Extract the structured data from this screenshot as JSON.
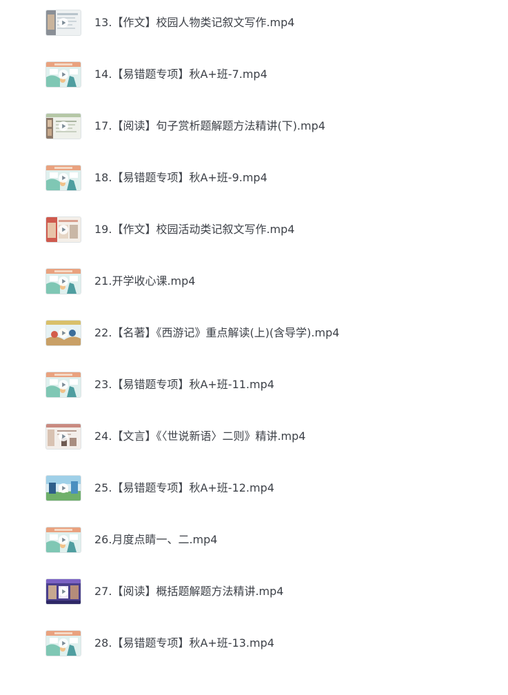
{
  "files": [
    {
      "name": "13.【作文】校园人物类记叙文写作.mp4",
      "thumb": "essay-portrait"
    },
    {
      "name": "14.【易错题专项】秋A+班-7.mp4",
      "thumb": "cartoon-fox"
    },
    {
      "name": "17.【阅读】句子赏析题解题方法精讲(下).mp4",
      "thumb": "reading-slide"
    },
    {
      "name": "18.【易错题专项】秋A+班-9.mp4",
      "thumb": "cartoon-fox"
    },
    {
      "name": "19.【作文】校园活动类记叙文写作.mp4",
      "thumb": "essay-red"
    },
    {
      "name": "21.开学收心课.mp4",
      "thumb": "cartoon-fox"
    },
    {
      "name": "22.【名著】《西游记》重点解读(上)(含导学).mp4",
      "thumb": "journey-west"
    },
    {
      "name": "23.【易错题专项】秋A+班-11.mp4",
      "thumb": "cartoon-fox"
    },
    {
      "name": "24.【文言】《〈世说新语〉二则》精讲.mp4",
      "thumb": "classical-slide"
    },
    {
      "name": "25.【易错题专项】秋A+班-12.mp4",
      "thumb": "cartoon-blue"
    },
    {
      "name": "26.月度点睛一、二.mp4",
      "thumb": "cartoon-fox"
    },
    {
      "name": "27.【阅读】概括题解题方法精讲.mp4",
      "thumb": "reading-purple"
    },
    {
      "name": "28.【易错题专项】秋A+班-13.mp4",
      "thumb": "cartoon-fox"
    }
  ]
}
